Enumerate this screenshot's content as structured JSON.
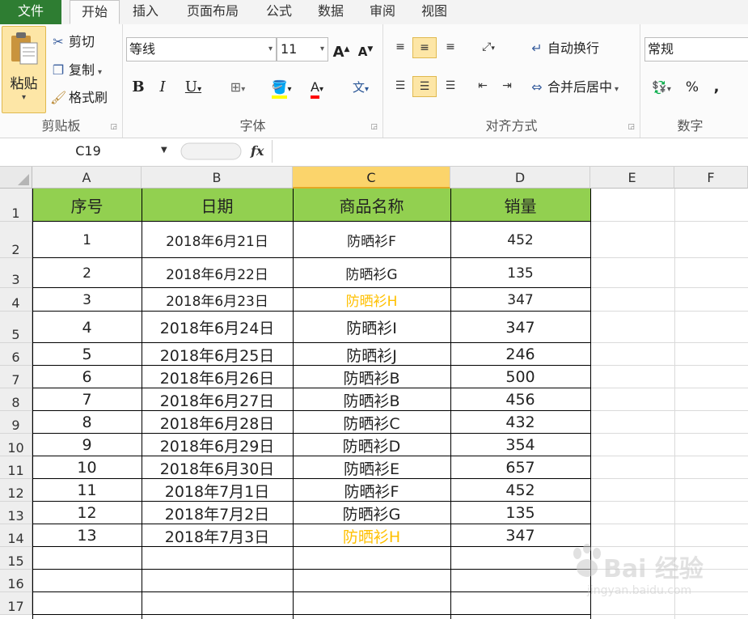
{
  "tabs": {
    "file": "文件",
    "items": [
      "开始",
      "插入",
      "页面布局",
      "公式",
      "数据",
      "审阅",
      "视图"
    ]
  },
  "ribbon": {
    "clipboard": {
      "paste": "粘贴",
      "cut": "剪切",
      "copy": "复制",
      "format_painter": "格式刷",
      "label": "剪贴板"
    },
    "font": {
      "name": "等线",
      "size": "11",
      "label": "字体"
    },
    "alignment": {
      "wrap_text": "自动换行",
      "merge_center": "合并后居中",
      "label": "对齐方式"
    },
    "number": {
      "format": "常规",
      "label": "数字"
    },
    "accent": "#fde6a6"
  },
  "formula_bar": {
    "name_box": "C19",
    "fx": "fx",
    "content": ""
  },
  "sheet": {
    "columns": [
      "A",
      "B",
      "C",
      "D",
      "E",
      "F"
    ],
    "selected_column": "C",
    "row_numbers": [
      "1",
      "2",
      "3",
      "4",
      "5",
      "6",
      "7",
      "8",
      "9",
      "10",
      "11",
      "12",
      "13",
      "14",
      "15",
      "16",
      "17"
    ],
    "header": [
      "序号",
      "日期",
      "商品名称",
      "销量"
    ],
    "header_color": "#92d050",
    "highlight_color": "#ffc000",
    "rows": [
      [
        "1",
        "2018年6月21日",
        "防晒衫F",
        "452"
      ],
      [
        "2",
        "2018年6月22日",
        "防晒衫G",
        "135"
      ],
      [
        "3",
        "2018年6月23日",
        "防晒衫H",
        "347"
      ],
      [
        "4",
        "2018年6月24日",
        "防晒衫I",
        "347"
      ],
      [
        "5",
        "2018年6月25日",
        "防晒衫J",
        "246"
      ],
      [
        "6",
        "2018年6月26日",
        "防晒衫B",
        "500"
      ],
      [
        "7",
        "2018年6月27日",
        "防晒衫B",
        "456"
      ],
      [
        "8",
        "2018年6月28日",
        "防晒衫C",
        "432"
      ],
      [
        "9",
        "2018年6月29日",
        "防晒衫D",
        "354"
      ],
      [
        "10",
        "2018年6月30日",
        "防晒衫E",
        "657"
      ],
      [
        "11",
        "2018年7月1日",
        "防晒衫F",
        "452"
      ],
      [
        "12",
        "2018年7月2日",
        "防晒衫G",
        "135"
      ],
      [
        "13",
        "2018年7月3日",
        "防晒衫H",
        "347"
      ]
    ],
    "highlighted_rows": [
      2,
      12
    ]
  },
  "watermark": {
    "brand": "Bai 经验",
    "url": "jingyan.baidu.com"
  }
}
